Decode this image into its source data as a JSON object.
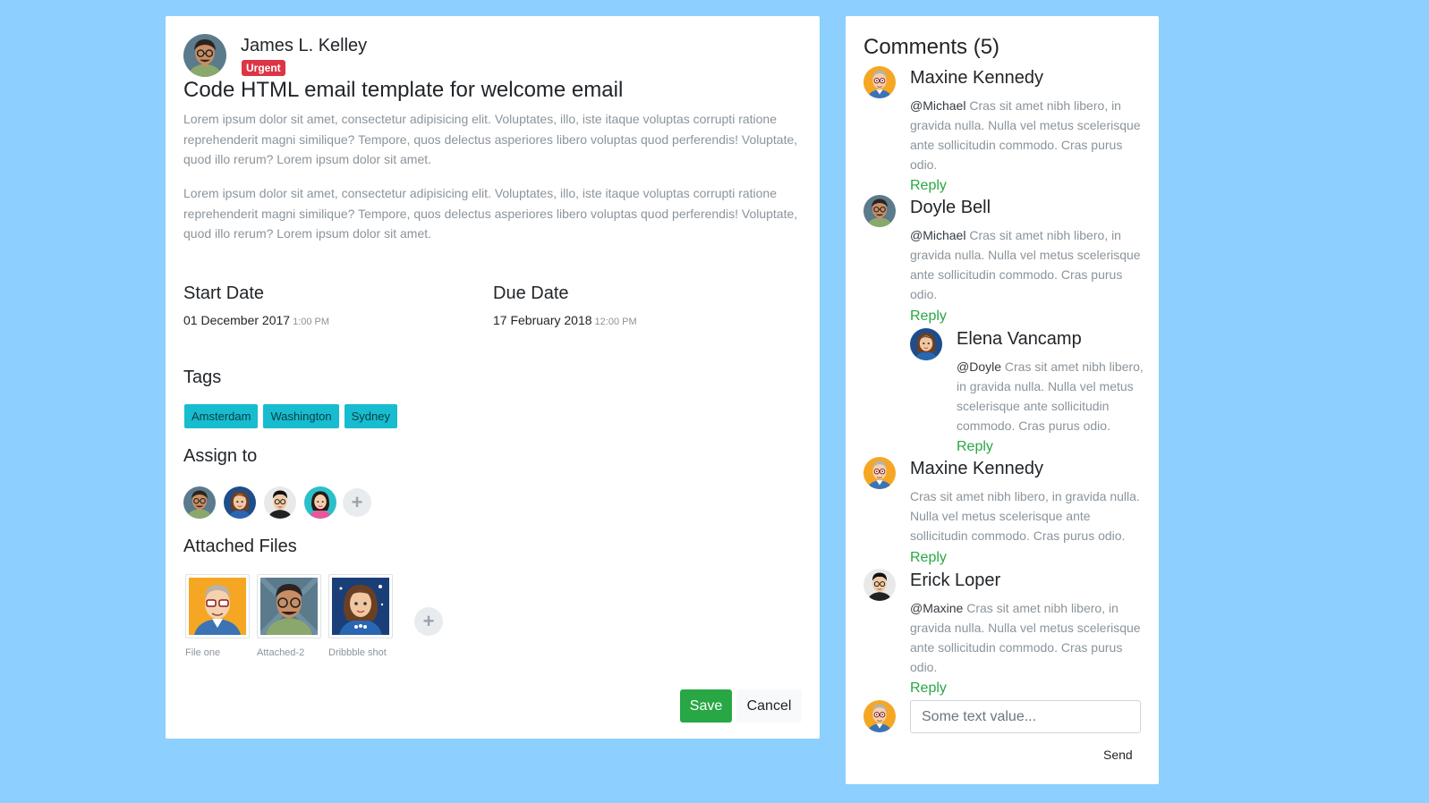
{
  "task": {
    "author": {
      "name": "James L. Kelley",
      "badge": "Urgent",
      "avatar": "male-glasses-avatar"
    },
    "title": "Code HTML email template for welcome email",
    "paragraphs": [
      "Lorem ipsum dolor sit amet, consectetur adipisicing elit. Voluptates, illo, iste itaque voluptas corrupti ratione reprehenderit magni similique? Tempore, quos delectus asperiores libero voluptas quod perferendis! Voluptate, quod illo rerum? Lorem ipsum dolor sit amet.",
      "Lorem ipsum dolor sit amet, consectetur adipisicing elit. Voluptates, illo, iste itaque voluptas corrupti ratione reprehenderit magni similique? Tempore, quos delectus asperiores libero voluptas quod perferendis! Voluptate, quod illo rerum? Lorem ipsum dolor sit amet."
    ],
    "start_date": {
      "label": "Start Date",
      "date": "01 December 2017",
      "time": "1:00 PM"
    },
    "due_date": {
      "label": "Due Date",
      "date": "17 February 2018",
      "time": "12:00 PM"
    },
    "tags_label": "Tags",
    "tags": [
      "Amsterdam",
      "Washington",
      "Sydney"
    ],
    "assign_label": "Assign to",
    "assignees": [
      "male-glasses-avatar",
      "female-brown-hair-avatar",
      "male-black-hair-avatar",
      "female-pink-avatar"
    ],
    "add_icon": "+",
    "files_label": "Attached Files",
    "files": [
      {
        "name": "File one",
        "thumb": "orange-glasses-portrait"
      },
      {
        "name": "Attached-2",
        "thumb": "green-glasses-portrait"
      },
      {
        "name": "Dribbble shot",
        "thumb": "blue-female-portrait"
      }
    ],
    "save_label": "Save",
    "cancel_label": "Cancel"
  },
  "comments": {
    "title": "Comments (5)",
    "items": [
      {
        "name": "Maxine Kennedy",
        "mention": "@Michael",
        "text": " Cras sit amet nibh libero, in gravida nulla. Nulla vel metus scelerisque ante sollicitudin commodo. Cras purus odio.",
        "reply": "Reply"
      },
      {
        "name": "Doyle Bell",
        "mention": "@Michael",
        "text": " Cras sit amet nibh libero, in gravida nulla. Nulla vel metus scelerisque ante sollicitudin commodo. Cras purus odio.",
        "reply": "Reply"
      },
      {
        "name": "Elena Vancamp",
        "mention": "@Doyle",
        "text": " Cras sit amet nibh libero, in gravida nulla. Nulla vel metus scelerisque ante sollicitudin commodo. Cras purus odio.",
        "reply": "Reply"
      },
      {
        "name": "Maxine Kennedy",
        "mention": "",
        "text": "Cras sit amet nibh libero, in gravida nulla. Nulla vel metus scelerisque ante sollicitudin commodo. Cras purus odio.",
        "reply": "Reply"
      },
      {
        "name": "Erick Loper",
        "mention": "@Maxine",
        "text": " Cras sit amet nibh libero, in gravida nulla. Nulla vel metus scelerisque ante sollicitudin commodo. Cras purus odio.",
        "reply": "Reply"
      }
    ],
    "input_placeholder": "Some text value...",
    "send_label": "Send"
  },
  "colors": {
    "page_background": "#8dcffe",
    "urgent": "#dc3545",
    "tag": "#17bccf",
    "save": "#28a745",
    "reply_link": "#28a745"
  }
}
